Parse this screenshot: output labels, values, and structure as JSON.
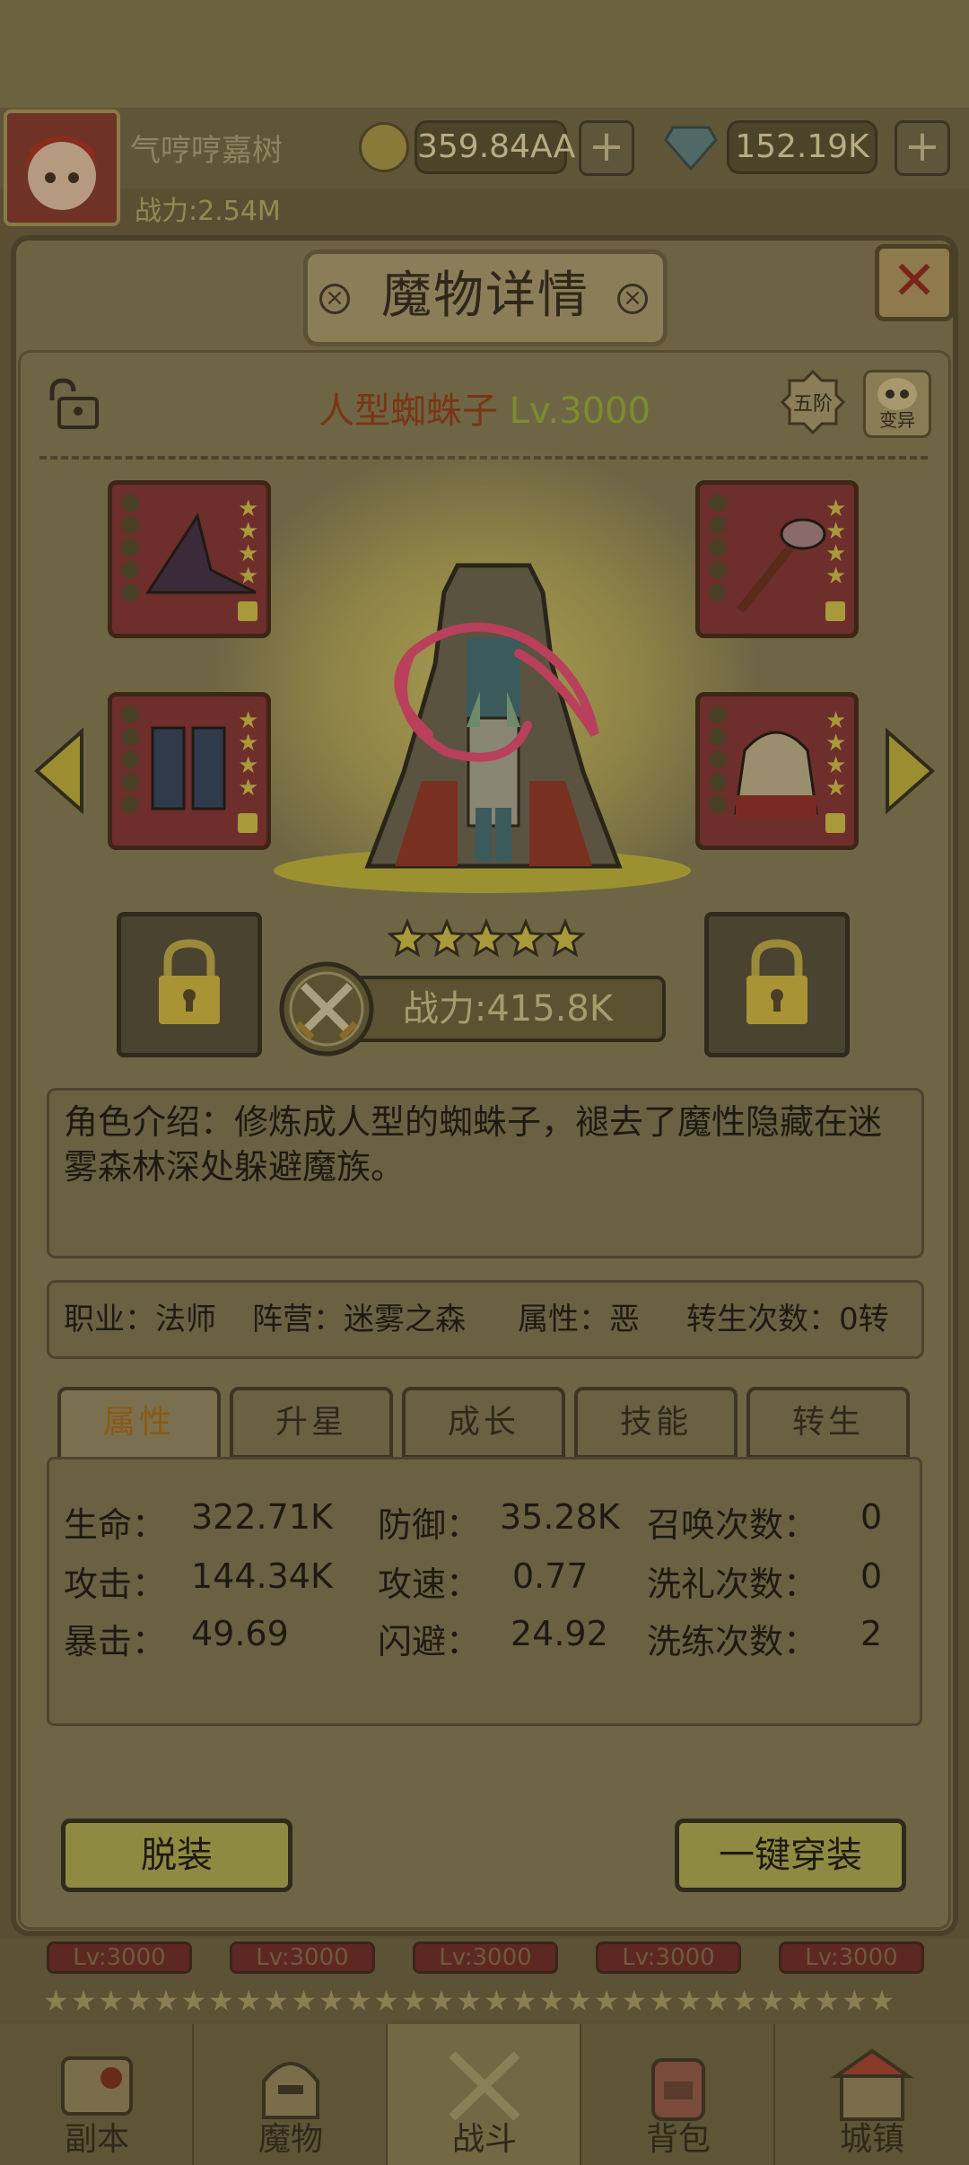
{
  "header": {
    "player_name": "气哼哼嘉树",
    "coins": "359.84AA",
    "gems": "152.19K",
    "power": "战力:2.54M"
  },
  "modal": {
    "title": "魔物详情",
    "monster_name": "人型蜘蛛子",
    "monster_level": "Lv.3000",
    "tier_badge": "五阶",
    "mutate_label": "变异",
    "star_rating": 5,
    "power": "战力:415.8K",
    "description": "角色介绍：修炼成人型的蜘蛛子，褪去了魔性隐藏在迷雾森林深处躲避魔族。",
    "info": {
      "job": "职业：法师",
      "camp": "阵营：迷雾之森",
      "attribute": "属性：恶",
      "rebirth": "转生次数：0转"
    },
    "tabs": [
      "属性",
      "升星",
      "成长",
      "技能",
      "转生"
    ],
    "active_tab": "属性",
    "stats": {
      "hp_label": "生命：",
      "hp": "322.71K",
      "def_label": "防御：",
      "def": "35.28K",
      "summon_label": "召唤次数：",
      "summon": "0",
      "atk_label": "攻击：",
      "atk": "144.34K",
      "aspd_label": "攻速：",
      "aspd": "0.77",
      "baptize_label": "洗礼次数：",
      "baptize": "0",
      "crit_label": "暴击：",
      "crit": "49.69",
      "dodge_label": "闪避：",
      "dodge": "24.92",
      "refine_label": "洗练次数：",
      "refine": "2"
    },
    "unequip_label": "脱装",
    "equip_all_label": "一键穿装"
  },
  "roster": {
    "levels": [
      "Lv:3000",
      "Lv:3000",
      "Lv:3000",
      "Lv:3000",
      "Lv:3000"
    ],
    "stars": "★★★★★★★★★★★★★★★★★★★★★★★★★★★★★★★"
  },
  "nav": {
    "items": [
      "副本",
      "魔物",
      "战斗",
      "背包",
      "城镇"
    ],
    "active": "战斗"
  },
  "colors": {
    "accent": "#9c9130",
    "equip_bg": "#6e2e2c",
    "close_x": "#7a2418"
  }
}
